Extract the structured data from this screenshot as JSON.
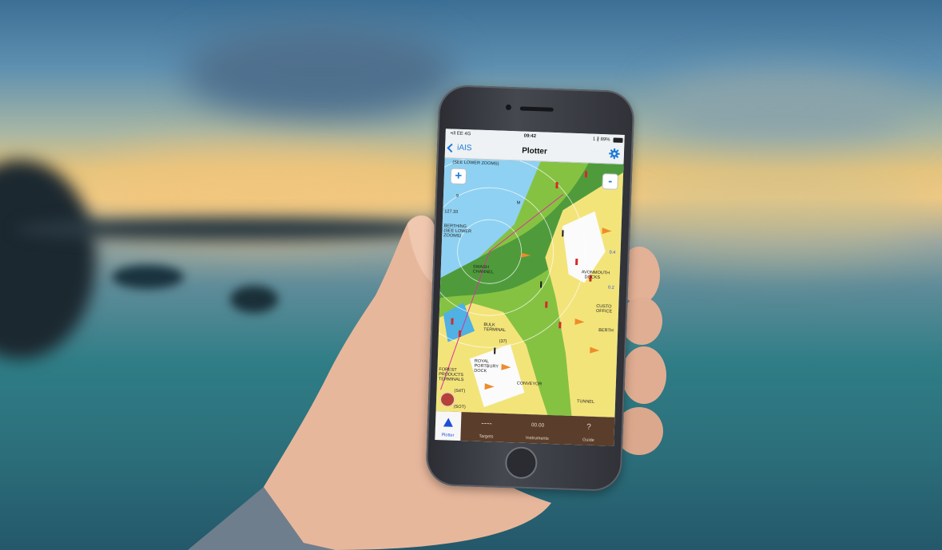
{
  "status_bar": {
    "signal": "•ıll EE 4G",
    "time": "09:42",
    "battery": "1 ∦ 89%"
  },
  "nav": {
    "back_label": "iAIS",
    "title": "Plotter",
    "settings_icon": "gear-icon"
  },
  "map": {
    "zoom_in": "+",
    "zoom_out": "-",
    "labels": {
      "see_lower": "(SEE LOWER ZOOMS)",
      "depth_a": "9",
      "depth_b": "127.33",
      "berthing": "BERTHING",
      "lower_zooms_a": "(SEE LOWER",
      "lower_zooms_b": "ZOOMS)",
      "swash": "SWASH",
      "channel": "CHANNEL",
      "avonmouth_a": "AVONMOUTH",
      "avonmouth_b": "DOCKS",
      "custom_a": "CUSTO",
      "custom_b": "OFFICE",
      "bulk_a": "BULK",
      "bulk_b": "TERMINAL",
      "royal_a": "ROYAL",
      "royal_b": "PORTBURY",
      "royal_c": "DOCK",
      "forest_a": "FOREST",
      "forest_b": "PRODUCTS",
      "forest_c": "TERMINALS",
      "conveyor": "CONVEYOR",
      "tunnel": "TUNNEL",
      "berth": "BERTH",
      "value_right_a": "0.4",
      "value_right_b": "0.2",
      "sog_label": "(S4T)",
      "sog_label_b": "(SOT)",
      "mark_37": "(37)",
      "mark_m": "M"
    }
  },
  "tabs": [
    {
      "label": "Plotter",
      "icon": "▲",
      "icon_name": "plotter-triangle-icon"
    },
    {
      "label": "Targets",
      "icon": "----",
      "icon_name": "targets-icon"
    },
    {
      "label": "Instruments",
      "icon": "00.00",
      "icon_name": "instruments-readout"
    },
    {
      "label": "Guide",
      "icon": "?",
      "icon_name": "guide-icon"
    }
  ],
  "colors": {
    "accent": "#1e7ad6",
    "tab_bg": "#5a3d2a",
    "land": "#f3e47a",
    "shoal": "#86c242",
    "water": "#3fa3dc"
  }
}
